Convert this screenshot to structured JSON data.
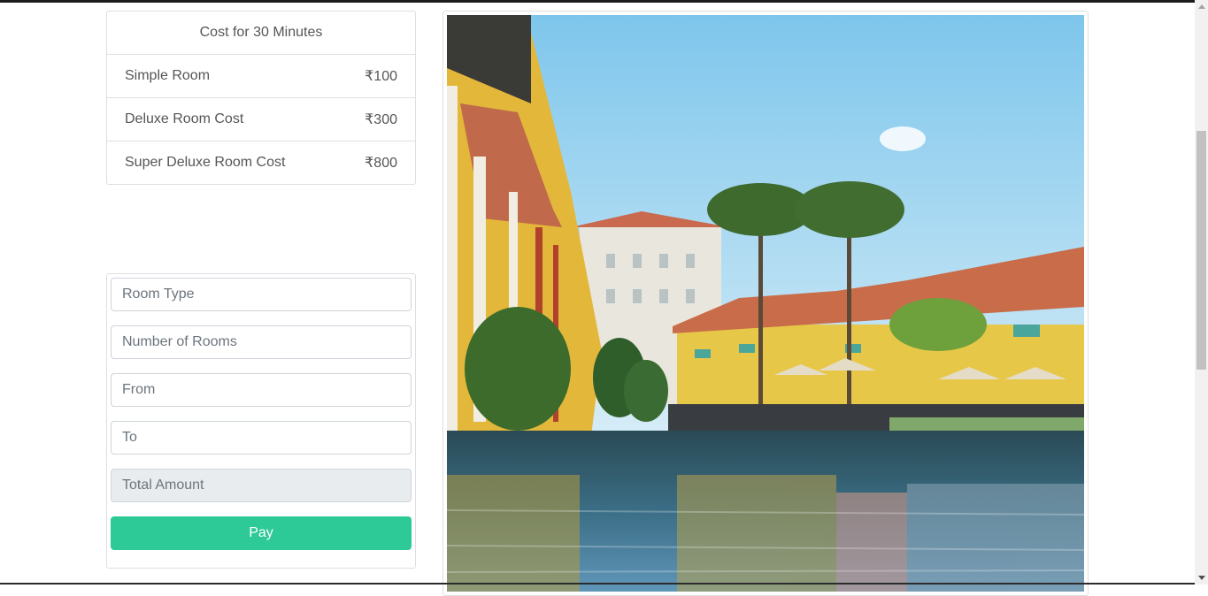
{
  "pricing": {
    "header": "Cost for 30 Minutes",
    "items": [
      {
        "label": "Simple Room",
        "price": "₹100"
      },
      {
        "label": "Deluxe Room Cost",
        "price": "₹300"
      },
      {
        "label": "Super Deluxe Room Cost",
        "price": "₹800"
      }
    ]
  },
  "form": {
    "room_type_placeholder": "Room Type",
    "rooms_placeholder": "Number of Rooms",
    "from_placeholder": "From",
    "to_placeholder": "To",
    "total_placeholder": "Total Amount",
    "pay_label": "Pay"
  },
  "colors": {
    "accent": "#2dc997",
    "border": "#dfdfdf",
    "readonly_bg": "#e9ecef"
  }
}
